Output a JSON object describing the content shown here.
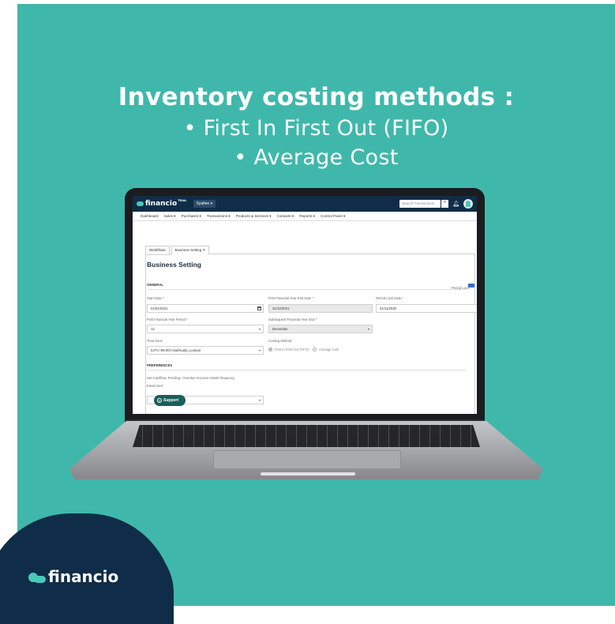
{
  "heading": {
    "title": "Inventory costing methods :",
    "bullet1": "• First In First Out (FIFO)",
    "bullet2": "• Average Cost"
  },
  "app": {
    "logo": "financio",
    "trial": "TRIAL",
    "user": "Syafiee ▾",
    "search_placeholder": "Search Transactions",
    "menu": [
      "Dashboard",
      "Sales ▾",
      "Purchases ▾",
      "Transactions ▾",
      "Products & Services ▾",
      "Contacts ▾",
      "Reports ▾",
      "Control Panel ▾"
    ],
    "tabs": [
      "Workflows",
      "Business Setting ✕"
    ],
    "page_title": "Business Setting",
    "general": "GENERAL",
    "period_lock": "Period Lock",
    "start_date_label": "Start Date *",
    "start_date": "01/01/2021",
    "fy_end_label": "First Financial Year End Date *",
    "fy_end": "31/12/2021",
    "lock_date_label": "Period Lock Date *",
    "lock_date": "01/11/2020",
    "fy_period_label": "First Financial Year Period *",
    "fy_period": "12",
    "subsequent_label": "Subsequent Financial Year End *",
    "subsequent": "December",
    "timezone_label": "Time Zone",
    "timezone": "(UTC+08:00) Asia/Kuala_Lumpur",
    "costing_label": "Costing Method",
    "costing_fifo": "First In First Out (FIFO)",
    "costing_avg": "Average Cost",
    "preferences": "PREFERENCES",
    "pref_desc": "Set Cashflow, Pending / Overdue Invoices emails frequency.",
    "email_alert": "Email Alert",
    "support": "Support"
  },
  "brand": {
    "name": "financio"
  }
}
